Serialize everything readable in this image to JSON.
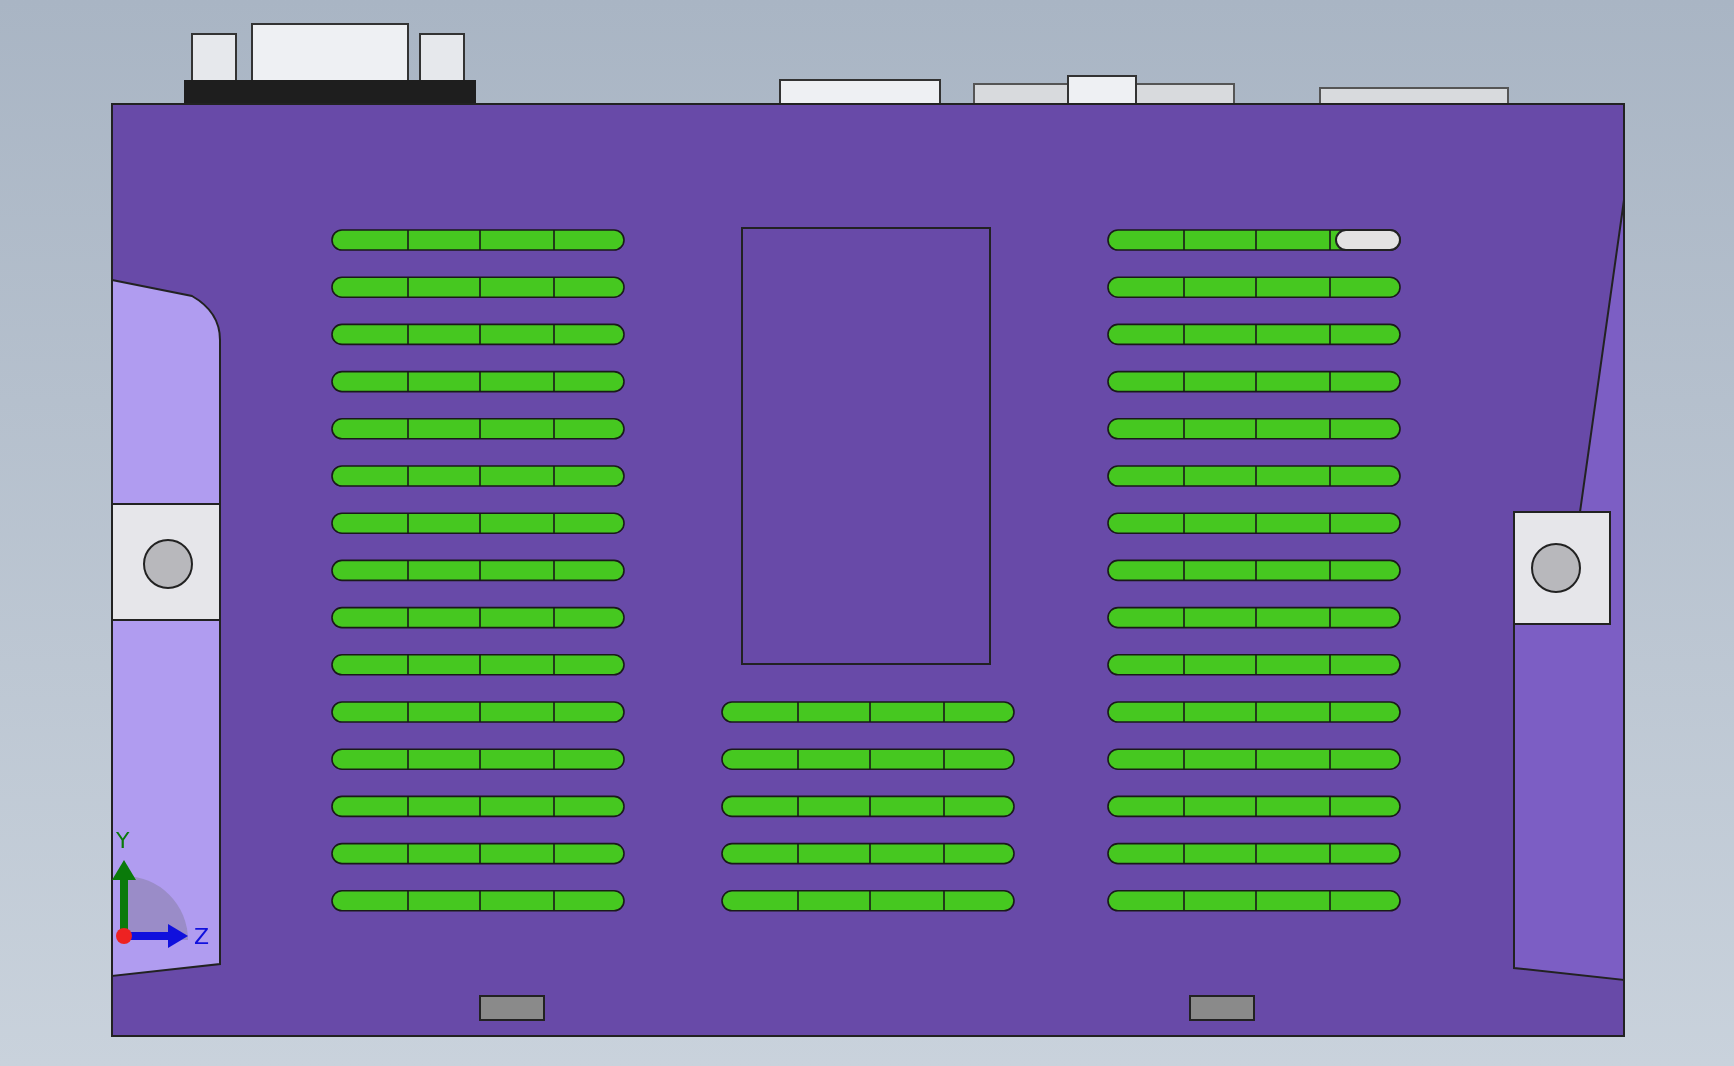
{
  "viewport": {
    "axes": [
      {
        "kind": "y",
        "label": "Y"
      },
      {
        "kind": "z",
        "label": "Z"
      }
    ]
  }
}
